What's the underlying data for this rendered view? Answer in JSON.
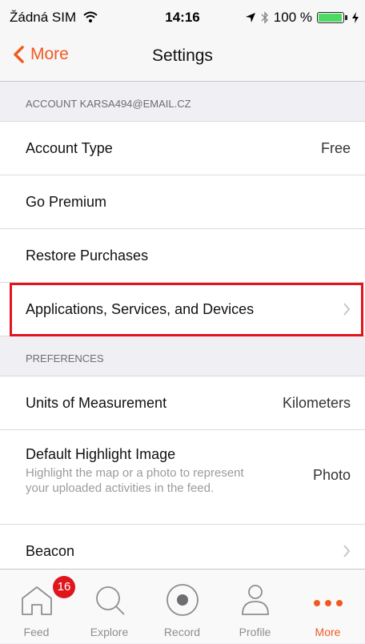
{
  "status_bar": {
    "carrier": "Žádná SIM",
    "time": "14:16",
    "battery_text": "100 %",
    "battery_level": 1.0
  },
  "nav": {
    "back_label": "More",
    "title": "Settings"
  },
  "sections": {
    "account_header": "ACCOUNT KARSA494@EMAIL.CZ",
    "account_type_label": "Account Type",
    "account_type_value": "Free",
    "go_premium": "Go Premium",
    "restore_purchases": "Restore Purchases",
    "applications": "Applications, Services, and Devices",
    "preferences_header": "PREFERENCES",
    "units_label": "Units of Measurement",
    "units_value": "Kilometers",
    "highlight_label": "Default Highlight Image",
    "highlight_sub": "Highlight the map or a photo to represent your uploaded activities in the feed.",
    "highlight_value": "Photo",
    "beacon": "Beacon"
  },
  "tabs": {
    "feed": "Feed",
    "feed_badge": "16",
    "explore": "Explore",
    "record": "Record",
    "profile": "Profile",
    "more": "More"
  },
  "colors": {
    "accent": "#f05a22",
    "highlight_border": "#e0161e",
    "badge": "#e0161e"
  }
}
